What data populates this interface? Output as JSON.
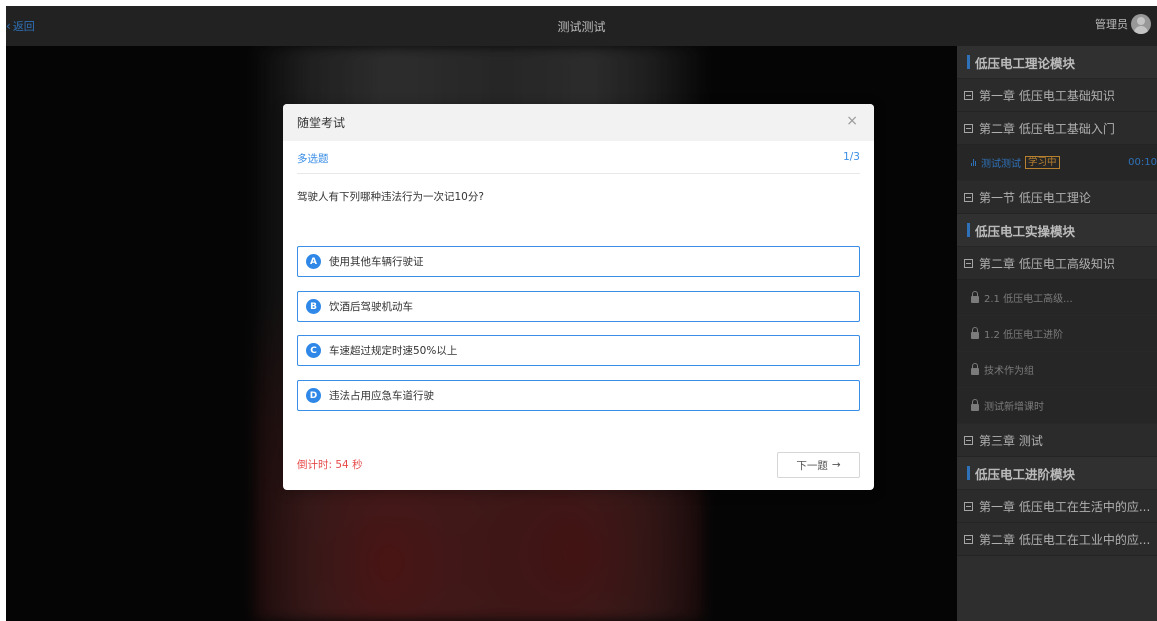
{
  "topbar": {
    "back_label": "返回",
    "title": "测试测试",
    "user_name": "管理员"
  },
  "sidebar": {
    "module1": "低压电工理论模块",
    "chapter1": "第一章 低压电工基础知识",
    "chapter2": "第二章 低压电工基础入门",
    "active_lesson": {
      "label": "测试测试",
      "badge": "学习中",
      "time": "00:10"
    },
    "section1": "第一节 低压电工理论",
    "module2": "低压电工实操模块",
    "chapter3": "第二章 低压电工高级知识",
    "lessons": [
      "2.1 低压电工高级...",
      "1.2 低压电工进阶",
      "技术作为组",
      "测试新增课时"
    ],
    "chapter4": "第三章 测试",
    "module3": "低压电工进阶模块",
    "chapter5": "第一章 低压电工在生活中的应...",
    "chapter6": "第二章 低压电工在工业中的应..."
  },
  "modal": {
    "title": "随堂考试",
    "close_glyph": "×",
    "question_type": "多选题",
    "progress": "1/3",
    "question": "驾驶人有下列哪种违法行为一次记10分?",
    "options": [
      {
        "letter": "A",
        "text": "使用其他车辆行驶证"
      },
      {
        "letter": "B",
        "text": "饮酒后驾驶机动车"
      },
      {
        "letter": "C",
        "text": "车速超过规定时速50%以上"
      },
      {
        "letter": "D",
        "text": "违法占用应急车道行驶"
      }
    ],
    "countdown": "倒计时: 54 秒",
    "next_label": "下一题",
    "next_arrow": "→"
  },
  "colors": {
    "accent": "#3a8ee6",
    "countdown": "#e64a4a",
    "badge": "#e6a23c"
  }
}
